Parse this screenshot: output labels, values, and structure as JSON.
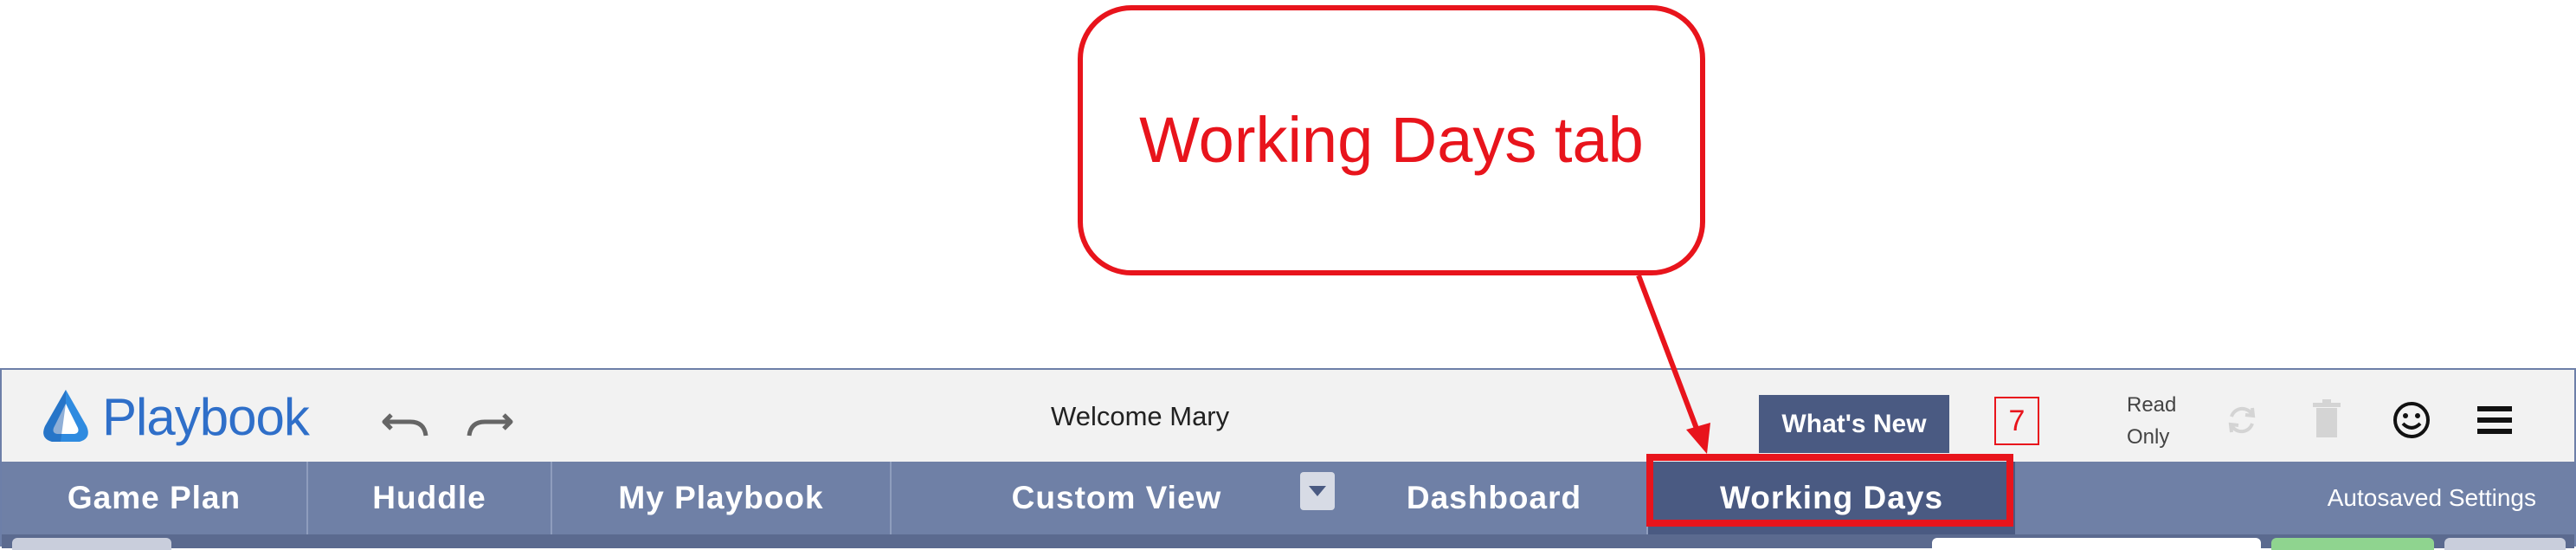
{
  "callout": {
    "text": "Working Days tab"
  },
  "app": {
    "logo_text": "Playbook",
    "welcome": "Welcome Mary",
    "whats_new_label": "What's New",
    "badge_count": "7",
    "read_only_line1": "Read",
    "read_only_line2": "Only",
    "icons": [
      "undo-icon",
      "redo-icon",
      "refresh-icon",
      "trash-icon",
      "smiley-icon",
      "menu-icon"
    ],
    "accent_color": "#e8141c",
    "tabbar_color": "#6f80a6",
    "active_tab_color": "#4a5a82"
  },
  "tabs": [
    {
      "label": "Game Plan"
    },
    {
      "label": "Huddle"
    },
    {
      "label": "My Playbook"
    },
    {
      "label": "Custom View"
    },
    {
      "label": "Dashboard"
    },
    {
      "label": "Working Days",
      "active": true
    }
  ],
  "autosaved": "Autosaved Settings"
}
